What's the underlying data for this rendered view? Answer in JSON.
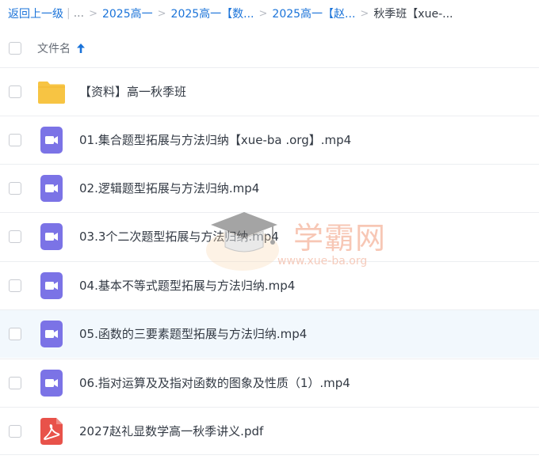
{
  "breadcrumb": {
    "back": "返回上一级",
    "bar": "|",
    "ellipsis": "...",
    "crumbs": [
      "2025高一",
      "2025高一【数...",
      "2025高一【赵..."
    ],
    "current": "秋季班【xue-..."
  },
  "header": {
    "column_name": "文件名"
  },
  "files": [
    {
      "name": "【资料】高一秋季班",
      "icon": "folder-icon"
    },
    {
      "name": "01.集合题型拓展与方法归纳【xue-ba .org】.mp4",
      "icon": "video-file-icon"
    },
    {
      "name": "02.逻辑题型拓展与方法归纳.mp4",
      "icon": "video-file-icon"
    },
    {
      "name": "03.3个二次题型拓展与方法归纳.mp4",
      "icon": "video-file-icon"
    },
    {
      "name": "04.基本不等式题型拓展与方法归纳.mp4",
      "icon": "video-file-icon"
    },
    {
      "name": "05.函数的三要素题型拓展与方法归纳.mp4",
      "icon": "video-file-icon"
    },
    {
      "name": "06.指对运算及及指对函数的图象及性质（1）.mp4",
      "icon": "video-file-icon"
    },
    {
      "name": "2027赵礼显数学高一秋季讲义.pdf",
      "icon": "pdf-file-icon"
    }
  ],
  "watermark": {
    "brand": "学霸网",
    "url": "www.xue-ba.org"
  },
  "colors": {
    "link": "#1a73d9",
    "folder": "#f7c443",
    "video": "#7b73e6",
    "pdf": "#e8524a",
    "hover_row": "#f2f8fd"
  }
}
